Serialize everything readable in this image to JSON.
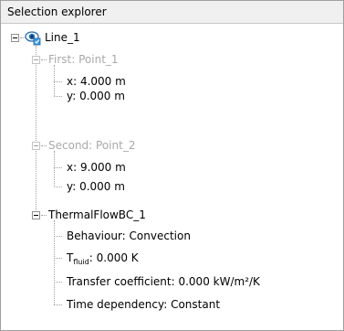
{
  "panel": {
    "title": "Selection explorer"
  },
  "tree": {
    "root": {
      "label": "Line_1",
      "icon": "eye-visibility-icon"
    },
    "first": {
      "label": "First: Point_1",
      "x": "x: 4.000 m",
      "y": "y: 0.000 m"
    },
    "second": {
      "label": "Second: Point_2",
      "x": "x: 9.000 m",
      "y": "y: 0.000 m"
    },
    "thermal": {
      "label": "ThermalFlowBC_1",
      "behaviour": "Behaviour: Convection",
      "tfluid_main": "T",
      "tfluid_sub": "fluid",
      "tfluid_value": ": 0.000 K",
      "transfer": "Transfer coefficient: 0.000 kW/m²/K",
      "time": "Time dependency: Constant"
    }
  },
  "colors": {
    "disabled_text": "#a9a9a9",
    "header_bg": "#f0f0f0",
    "eye_blue": "#2b7cc7"
  }
}
